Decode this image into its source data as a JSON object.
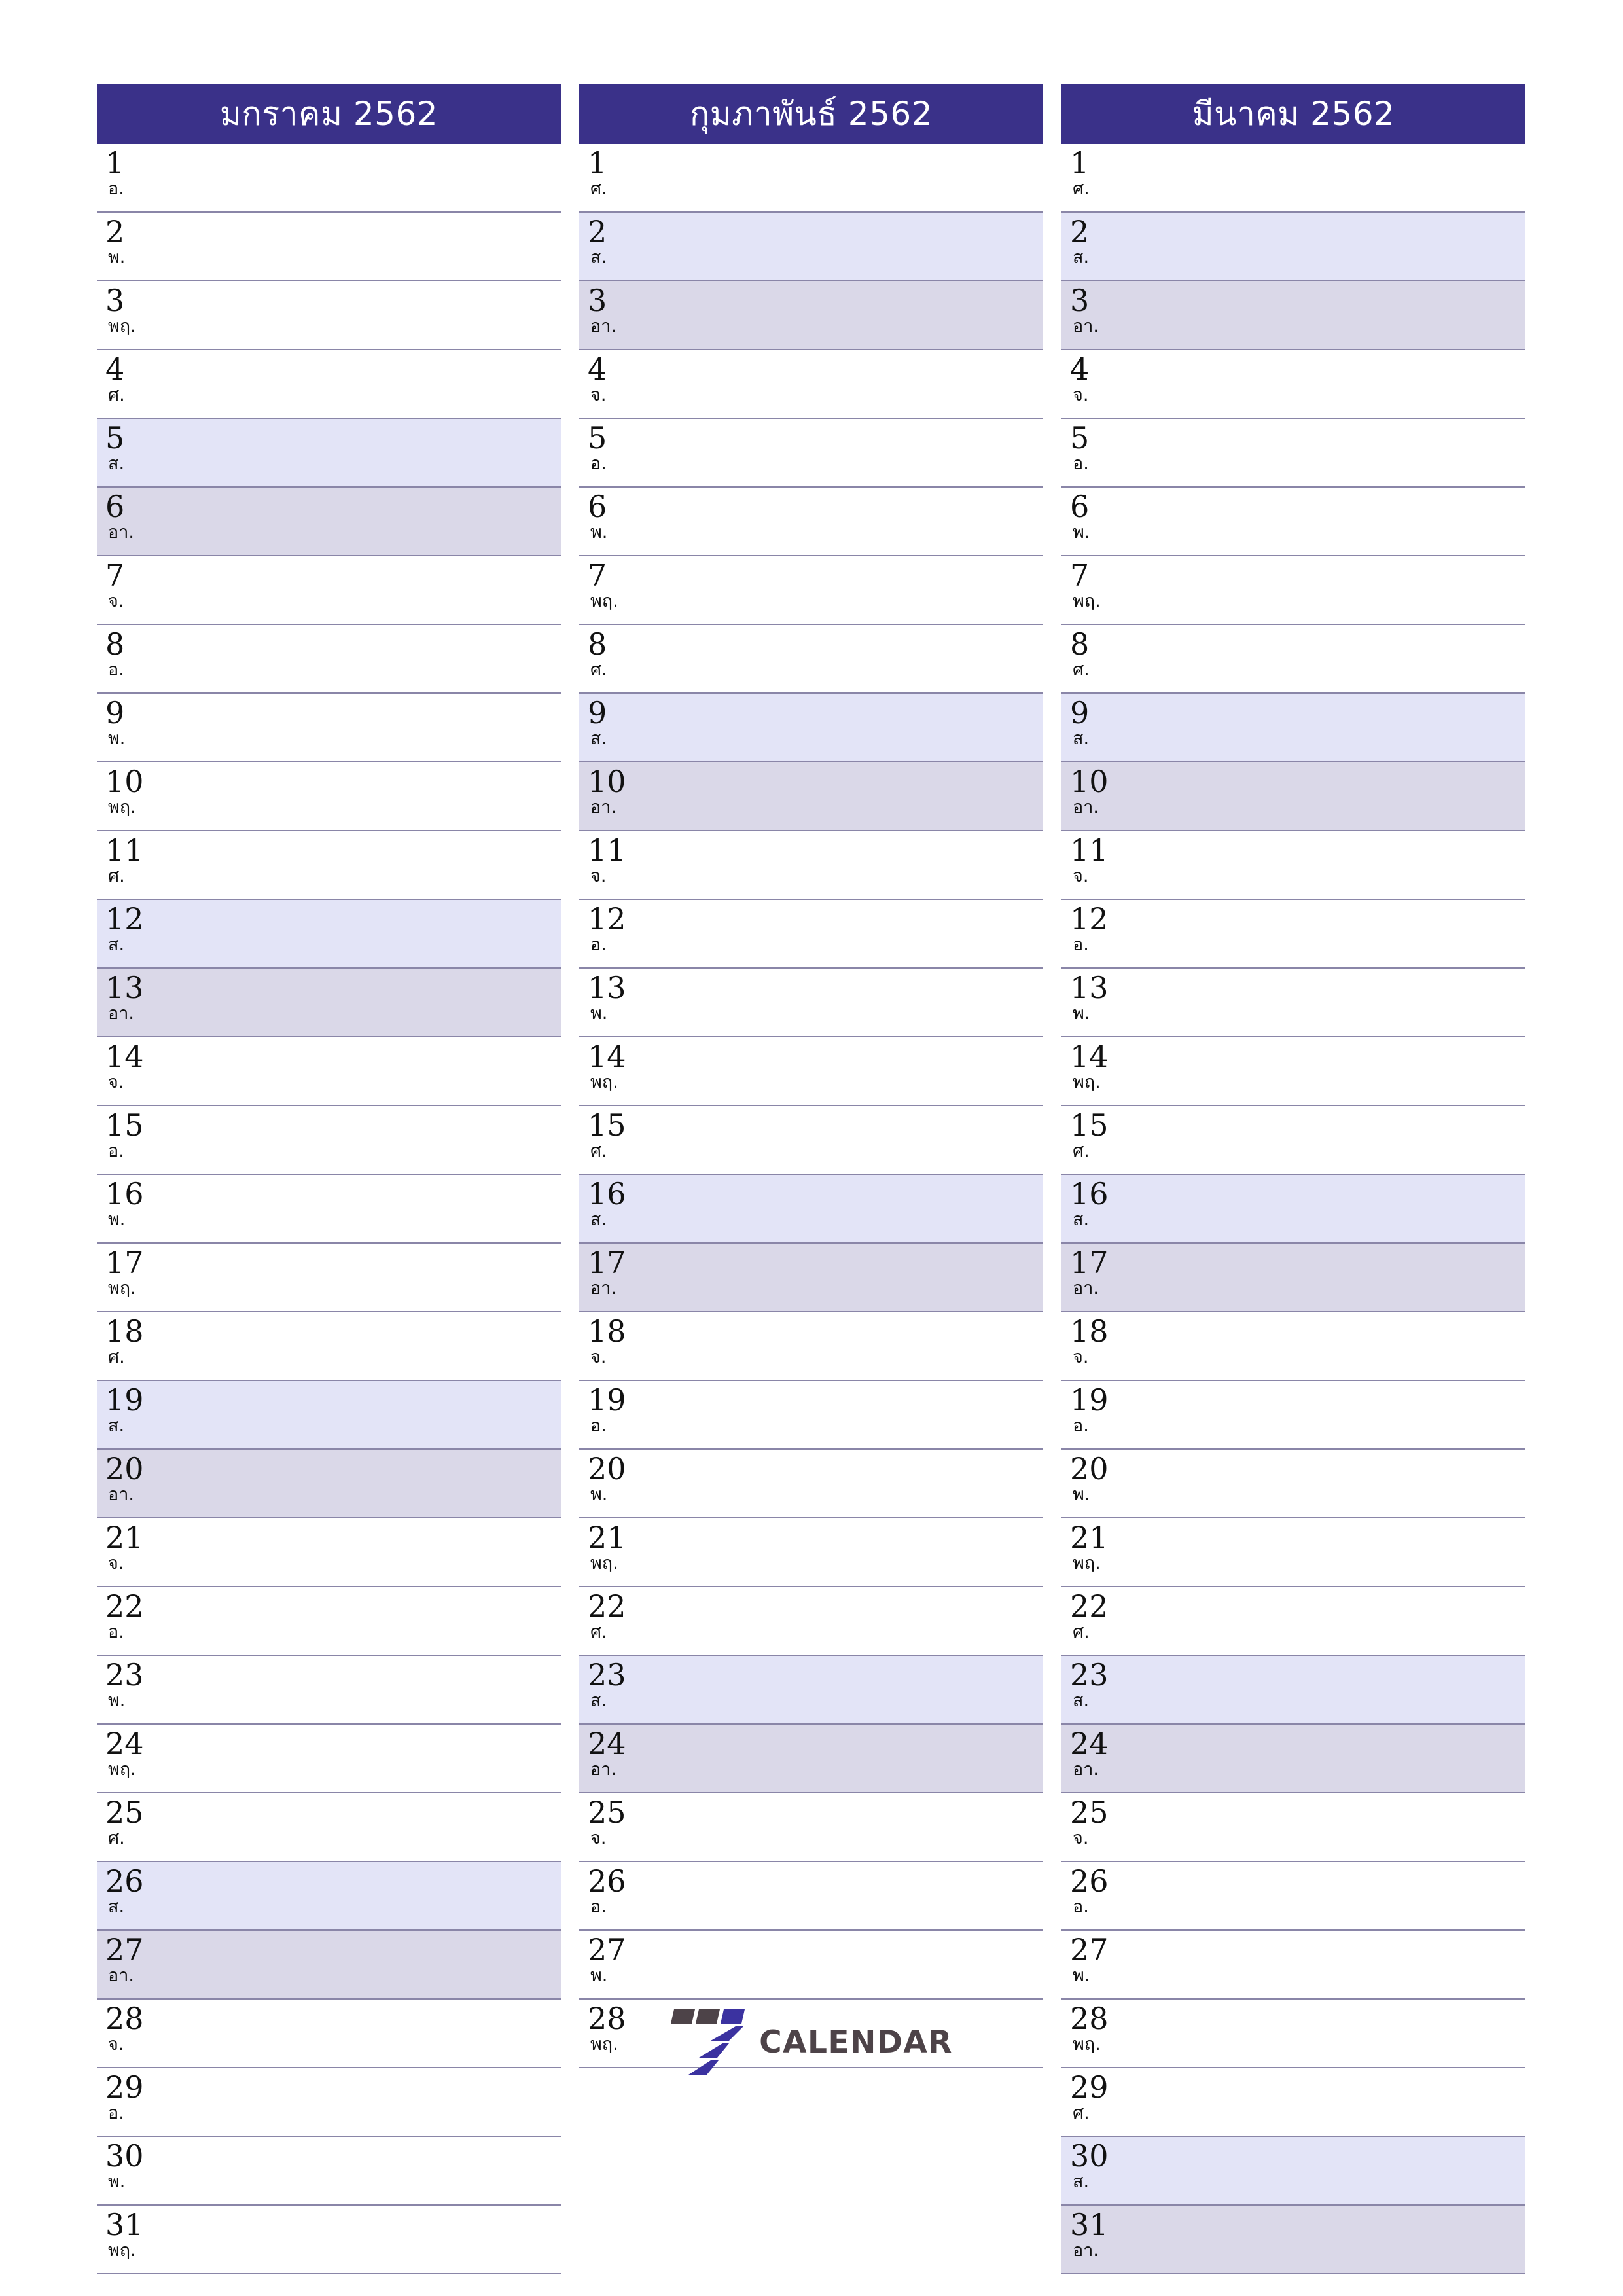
{
  "colors": {
    "header_bg": "#3a3189",
    "header_text": "#ffffff",
    "saturday_bg": "#e3e4f7",
    "sunday_bg": "#dad8e8",
    "row_divider": "#8a86a8",
    "day_text": "#111111",
    "logo_gray": "#4d4348",
    "logo_blue": "#3b32a0"
  },
  "weekday_abbr": {
    "sun": "อา.",
    "mon": "จ.",
    "tue": "อ.",
    "wed": "พ.",
    "thu": "พฤ.",
    "fri": "ศ.",
    "sat": "ส."
  },
  "logo": {
    "word": "CALENDAR",
    "mark": "seven-blocks"
  },
  "months": [
    {
      "title": "มกราคม 2562",
      "days": [
        {
          "num": "1",
          "wd": "อ.",
          "type": "weekday"
        },
        {
          "num": "2",
          "wd": "พ.",
          "type": "weekday"
        },
        {
          "num": "3",
          "wd": "พฤ.",
          "type": "weekday"
        },
        {
          "num": "4",
          "wd": "ศ.",
          "type": "weekday"
        },
        {
          "num": "5",
          "wd": "ส.",
          "type": "sat"
        },
        {
          "num": "6",
          "wd": "อา.",
          "type": "sun"
        },
        {
          "num": "7",
          "wd": "จ.",
          "type": "weekday"
        },
        {
          "num": "8",
          "wd": "อ.",
          "type": "weekday"
        },
        {
          "num": "9",
          "wd": "พ.",
          "type": "weekday"
        },
        {
          "num": "10",
          "wd": "พฤ.",
          "type": "weekday"
        },
        {
          "num": "11",
          "wd": "ศ.",
          "type": "weekday"
        },
        {
          "num": "12",
          "wd": "ส.",
          "type": "sat"
        },
        {
          "num": "13",
          "wd": "อา.",
          "type": "sun"
        },
        {
          "num": "14",
          "wd": "จ.",
          "type": "weekday"
        },
        {
          "num": "15",
          "wd": "อ.",
          "type": "weekday"
        },
        {
          "num": "16",
          "wd": "พ.",
          "type": "weekday"
        },
        {
          "num": "17",
          "wd": "พฤ.",
          "type": "weekday"
        },
        {
          "num": "18",
          "wd": "ศ.",
          "type": "weekday"
        },
        {
          "num": "19",
          "wd": "ส.",
          "type": "sat"
        },
        {
          "num": "20",
          "wd": "อา.",
          "type": "sun"
        },
        {
          "num": "21",
          "wd": "จ.",
          "type": "weekday"
        },
        {
          "num": "22",
          "wd": "อ.",
          "type": "weekday"
        },
        {
          "num": "23",
          "wd": "พ.",
          "type": "weekday"
        },
        {
          "num": "24",
          "wd": "พฤ.",
          "type": "weekday"
        },
        {
          "num": "25",
          "wd": "ศ.",
          "type": "weekday"
        },
        {
          "num": "26",
          "wd": "ส.",
          "type": "sat"
        },
        {
          "num": "27",
          "wd": "อา.",
          "type": "sun"
        },
        {
          "num": "28",
          "wd": "จ.",
          "type": "weekday"
        },
        {
          "num": "29",
          "wd": "อ.",
          "type": "weekday"
        },
        {
          "num": "30",
          "wd": "พ.",
          "type": "weekday"
        },
        {
          "num": "31",
          "wd": "พฤ.",
          "type": "weekday"
        }
      ]
    },
    {
      "title": "กุมภาพันธ์ 2562",
      "days": [
        {
          "num": "1",
          "wd": "ศ.",
          "type": "weekday"
        },
        {
          "num": "2",
          "wd": "ส.",
          "type": "sat"
        },
        {
          "num": "3",
          "wd": "อา.",
          "type": "sun"
        },
        {
          "num": "4",
          "wd": "จ.",
          "type": "weekday"
        },
        {
          "num": "5",
          "wd": "อ.",
          "type": "weekday"
        },
        {
          "num": "6",
          "wd": "พ.",
          "type": "weekday"
        },
        {
          "num": "7",
          "wd": "พฤ.",
          "type": "weekday"
        },
        {
          "num": "8",
          "wd": "ศ.",
          "type": "weekday"
        },
        {
          "num": "9",
          "wd": "ส.",
          "type": "sat"
        },
        {
          "num": "10",
          "wd": "อา.",
          "type": "sun"
        },
        {
          "num": "11",
          "wd": "จ.",
          "type": "weekday"
        },
        {
          "num": "12",
          "wd": "อ.",
          "type": "weekday"
        },
        {
          "num": "13",
          "wd": "พ.",
          "type": "weekday"
        },
        {
          "num": "14",
          "wd": "พฤ.",
          "type": "weekday"
        },
        {
          "num": "15",
          "wd": "ศ.",
          "type": "weekday"
        },
        {
          "num": "16",
          "wd": "ส.",
          "type": "sat"
        },
        {
          "num": "17",
          "wd": "อา.",
          "type": "sun"
        },
        {
          "num": "18",
          "wd": "จ.",
          "type": "weekday"
        },
        {
          "num": "19",
          "wd": "อ.",
          "type": "weekday"
        },
        {
          "num": "20",
          "wd": "พ.",
          "type": "weekday"
        },
        {
          "num": "21",
          "wd": "พฤ.",
          "type": "weekday"
        },
        {
          "num": "22",
          "wd": "ศ.",
          "type": "weekday"
        },
        {
          "num": "23",
          "wd": "ส.",
          "type": "sat"
        },
        {
          "num": "24",
          "wd": "อา.",
          "type": "sun"
        },
        {
          "num": "25",
          "wd": "จ.",
          "type": "weekday"
        },
        {
          "num": "26",
          "wd": "อ.",
          "type": "weekday"
        },
        {
          "num": "27",
          "wd": "พ.",
          "type": "weekday"
        },
        {
          "num": "28",
          "wd": "พฤ.",
          "type": "weekday"
        }
      ]
    },
    {
      "title": "มีนาคม 2562",
      "days": [
        {
          "num": "1",
          "wd": "ศ.",
          "type": "weekday"
        },
        {
          "num": "2",
          "wd": "ส.",
          "type": "sat"
        },
        {
          "num": "3",
          "wd": "อา.",
          "type": "sun"
        },
        {
          "num": "4",
          "wd": "จ.",
          "type": "weekday"
        },
        {
          "num": "5",
          "wd": "อ.",
          "type": "weekday"
        },
        {
          "num": "6",
          "wd": "พ.",
          "type": "weekday"
        },
        {
          "num": "7",
          "wd": "พฤ.",
          "type": "weekday"
        },
        {
          "num": "8",
          "wd": "ศ.",
          "type": "weekday"
        },
        {
          "num": "9",
          "wd": "ส.",
          "type": "sat"
        },
        {
          "num": "10",
          "wd": "อา.",
          "type": "sun"
        },
        {
          "num": "11",
          "wd": "จ.",
          "type": "weekday"
        },
        {
          "num": "12",
          "wd": "อ.",
          "type": "weekday"
        },
        {
          "num": "13",
          "wd": "พ.",
          "type": "weekday"
        },
        {
          "num": "14",
          "wd": "พฤ.",
          "type": "weekday"
        },
        {
          "num": "15",
          "wd": "ศ.",
          "type": "weekday"
        },
        {
          "num": "16",
          "wd": "ส.",
          "type": "sat"
        },
        {
          "num": "17",
          "wd": "อา.",
          "type": "sun"
        },
        {
          "num": "18",
          "wd": "จ.",
          "type": "weekday"
        },
        {
          "num": "19",
          "wd": "อ.",
          "type": "weekday"
        },
        {
          "num": "20",
          "wd": "พ.",
          "type": "weekday"
        },
        {
          "num": "21",
          "wd": "พฤ.",
          "type": "weekday"
        },
        {
          "num": "22",
          "wd": "ศ.",
          "type": "weekday"
        },
        {
          "num": "23",
          "wd": "ส.",
          "type": "sat"
        },
        {
          "num": "24",
          "wd": "อา.",
          "type": "sun"
        },
        {
          "num": "25",
          "wd": "จ.",
          "type": "weekday"
        },
        {
          "num": "26",
          "wd": "อ.",
          "type": "weekday"
        },
        {
          "num": "27",
          "wd": "พ.",
          "type": "weekday"
        },
        {
          "num": "28",
          "wd": "พฤ.",
          "type": "weekday"
        },
        {
          "num": "29",
          "wd": "ศ.",
          "type": "weekday"
        },
        {
          "num": "30",
          "wd": "ส.",
          "type": "sat"
        },
        {
          "num": "31",
          "wd": "อา.",
          "type": "sun"
        }
      ]
    }
  ]
}
